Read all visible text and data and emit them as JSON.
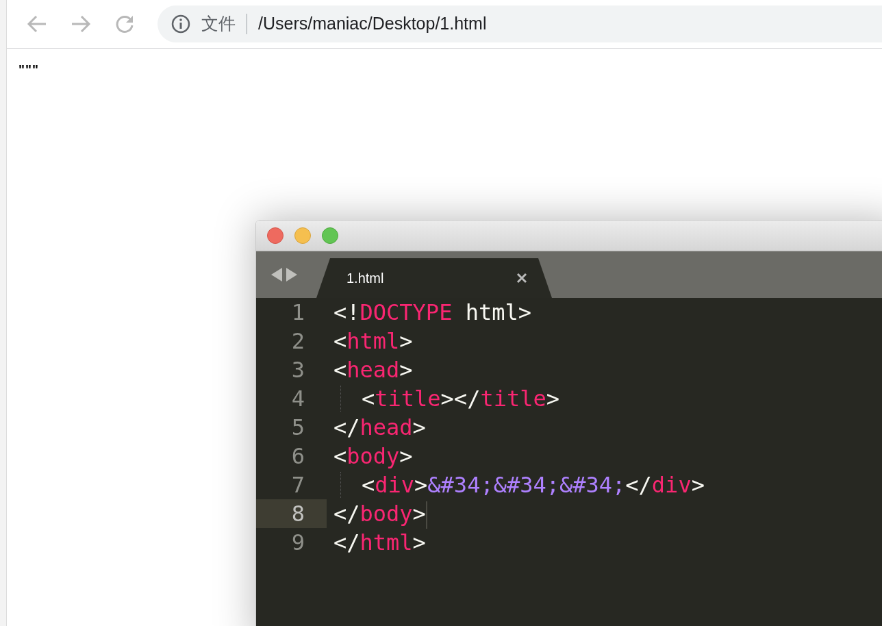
{
  "browser": {
    "address": {
      "scheme_label": "文件",
      "path": "/Users/maniac/Desktop/1.html"
    },
    "page_text": "\"\"\""
  },
  "editor": {
    "tabs": [
      {
        "label": "1.html",
        "selected": true
      }
    ],
    "lines": [
      {
        "number": "1",
        "current": false,
        "indent": false,
        "tokens": [
          {
            "kind": "punct",
            "text": "<!"
          },
          {
            "kind": "tag",
            "text": "DOCTYPE"
          },
          {
            "kind": "punct",
            "text": " html>"
          }
        ]
      },
      {
        "number": "2",
        "current": false,
        "indent": false,
        "tokens": [
          {
            "kind": "punct",
            "text": "<"
          },
          {
            "kind": "tag",
            "text": "html"
          },
          {
            "kind": "punct",
            "text": ">"
          }
        ]
      },
      {
        "number": "3",
        "current": false,
        "indent": false,
        "tokens": [
          {
            "kind": "punct",
            "text": "<"
          },
          {
            "kind": "tag",
            "text": "head"
          },
          {
            "kind": "punct",
            "text": ">"
          }
        ]
      },
      {
        "number": "4",
        "current": false,
        "indent": true,
        "tokens": [
          {
            "kind": "punct",
            "text": "<"
          },
          {
            "kind": "tag",
            "text": "title"
          },
          {
            "kind": "punct",
            "text": "></"
          },
          {
            "kind": "tag",
            "text": "title"
          },
          {
            "kind": "punct",
            "text": ">"
          }
        ]
      },
      {
        "number": "5",
        "current": false,
        "indent": false,
        "tokens": [
          {
            "kind": "punct",
            "text": "</"
          },
          {
            "kind": "tag",
            "text": "head"
          },
          {
            "kind": "punct",
            "text": ">"
          }
        ]
      },
      {
        "number": "6",
        "current": false,
        "indent": false,
        "tokens": [
          {
            "kind": "punct",
            "text": "<"
          },
          {
            "kind": "tag",
            "text": "body"
          },
          {
            "kind": "punct",
            "text": ">"
          }
        ]
      },
      {
        "number": "7",
        "current": false,
        "indent": true,
        "tokens": [
          {
            "kind": "punct",
            "text": "<"
          },
          {
            "kind": "tag",
            "text": "div"
          },
          {
            "kind": "punct",
            "text": ">"
          },
          {
            "kind": "entity",
            "text": "&#34;&#34;&#34;"
          },
          {
            "kind": "punct",
            "text": "</"
          },
          {
            "kind": "tag",
            "text": "div"
          },
          {
            "kind": "punct",
            "text": ">"
          }
        ]
      },
      {
        "number": "8",
        "current": true,
        "indent": false,
        "tokens": [
          {
            "kind": "punct",
            "text": "</"
          },
          {
            "kind": "tag",
            "text": "body"
          },
          {
            "kind": "punct",
            "text": ">"
          }
        ]
      },
      {
        "number": "9",
        "current": false,
        "indent": false,
        "tokens": [
          {
            "kind": "punct",
            "text": "</"
          },
          {
            "kind": "tag",
            "text": "html"
          },
          {
            "kind": "punct",
            "text": ">"
          }
        ]
      }
    ]
  }
}
